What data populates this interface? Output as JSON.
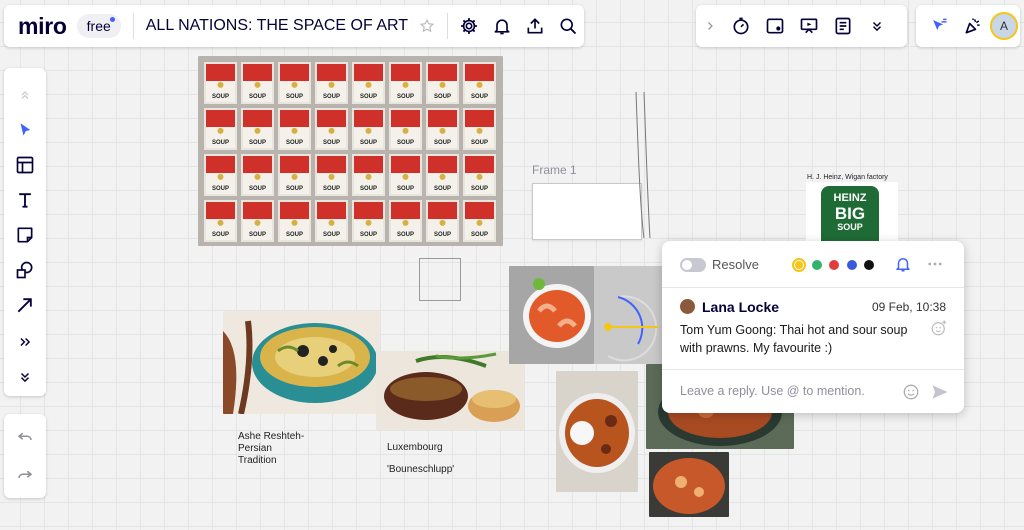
{
  "app": {
    "logo": "miro",
    "plan_badge": "free"
  },
  "board": {
    "title": "ALL NATIONS: THE SPACE OF ART"
  },
  "topbar_icons": [
    "star-icon",
    "gear-icon",
    "bell-icon",
    "upload-icon",
    "search-icon"
  ],
  "toolbar2_icons": [
    "chevron-right-icon",
    "timer-icon",
    "card-icon",
    "presentation-icon",
    "notes-icon",
    "chevrons-down-icon"
  ],
  "toolbar3_icons": [
    "cursor-reactions-icon",
    "celebrate-icon"
  ],
  "user": {
    "avatar_initial": "A"
  },
  "left_tools": [
    "chevrons-up-icon",
    "select-icon",
    "templates-icon",
    "text-icon",
    "sticky-note-icon",
    "shapes-icon",
    "arrow-icon",
    "more-icon",
    "collapse-icon"
  ],
  "history": [
    "undo-icon",
    "redo-icon"
  ],
  "canvas": {
    "frame_label": "Frame 1",
    "heinz_caption": "H. J. Heinz, Wigan factory",
    "heinz_label_line1": "HEINZ",
    "heinz_label_line2": "BIG",
    "heinz_label_line3": "SOUP",
    "persian_caption_line1": "Ashe Reshteh-",
    "persian_caption_line2": "Persian",
    "persian_caption_line3": "Tradition",
    "lux_caption_line1": "Luxembourg",
    "lux_caption_line2": "'Bouneschlupp'",
    "soup_label_word": "SOUP"
  },
  "comment": {
    "resolve_label": "Resolve",
    "colors": [
      "#f5c518",
      "#33b36a",
      "#e03e3e",
      "#3a5bd9",
      "#111111"
    ],
    "author": "Lana Locke",
    "date": "09 Feb, 10:38",
    "text": "Tom Yum Goong: Thai hot and sour soup with prawns. My favourite :)",
    "reply_placeholder": "Leave a reply. Use @ to mention."
  },
  "colors": {
    "accent": "#4262ff",
    "ink": "#050038"
  }
}
